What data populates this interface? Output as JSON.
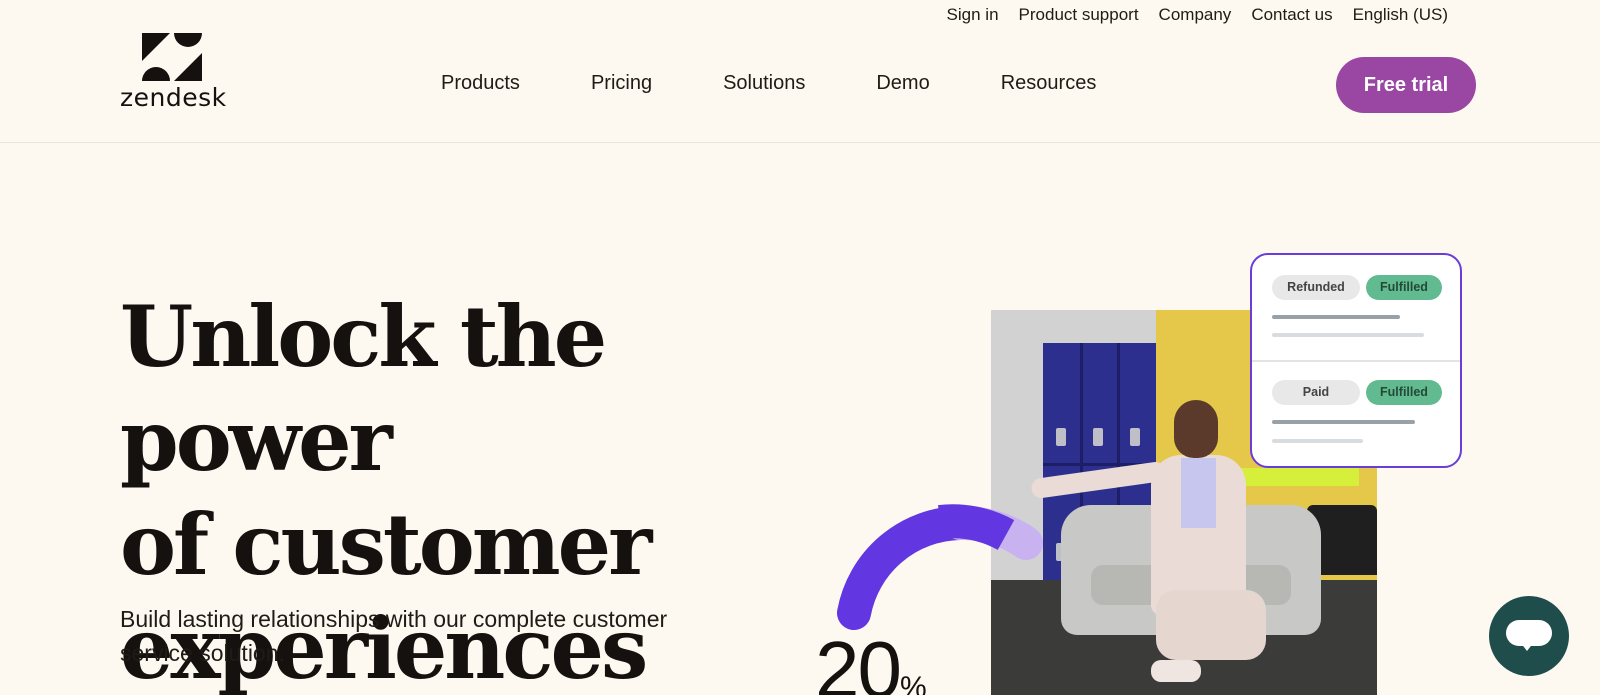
{
  "header": {
    "utility_links": [
      "Sign in",
      "Product support",
      "Company",
      "Contact us",
      "English (US)"
    ],
    "logo_text": "zendesk",
    "nav": [
      "Products",
      "Pricing",
      "Solutions",
      "Demo",
      "Resources"
    ],
    "cta_label": "Free trial"
  },
  "hero": {
    "title_lines": [
      "Unlock the power",
      "of customer",
      "experiences"
    ],
    "subtitle_lines": [
      "Build lasting relationships with our complete customer",
      "service solution."
    ],
    "stat_value": "20",
    "stat_unit": "%"
  },
  "card": {
    "row1": [
      "Refunded",
      "Fulfilled"
    ],
    "row2": [
      "Paid",
      "Fulfilled"
    ]
  },
  "colors": {
    "background": "#fdf9f1",
    "accent": "#9a47a3",
    "card_border": "#6a3dd8",
    "arc_primary": "#6236e0",
    "arc_secondary": "#c9b2f0",
    "chat": "#1f4d4c"
  },
  "icons": {
    "logo": "zendesk-z-icon",
    "chat": "chat-bubble-icon"
  }
}
